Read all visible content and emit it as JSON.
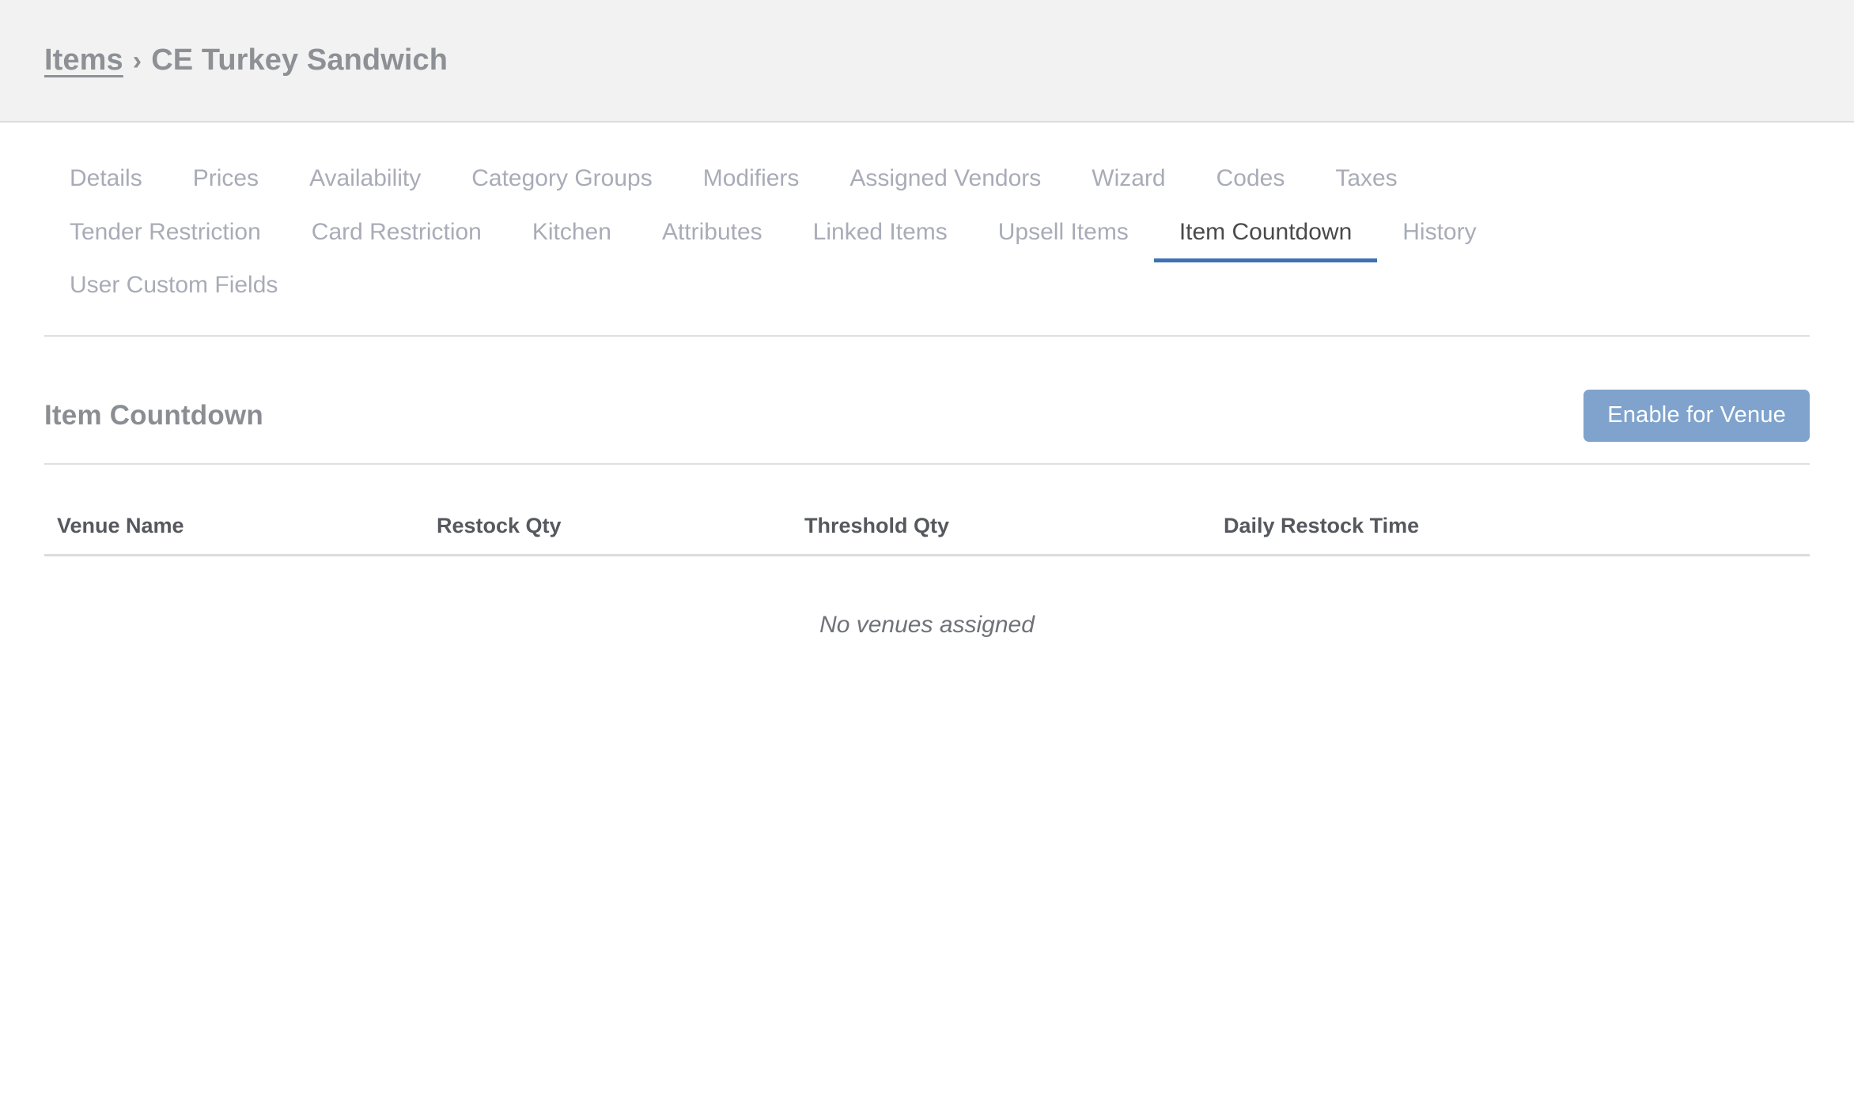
{
  "header": {
    "breadcrumb": {
      "root_label": "Items",
      "separator": "›",
      "current_label": "CE Turkey Sandwich"
    }
  },
  "tabs": {
    "active": "Item Countdown",
    "rows": [
      [
        {
          "label": "Details",
          "active": false
        },
        {
          "label": "Prices",
          "active": false
        },
        {
          "label": "Availability",
          "active": false
        },
        {
          "label": "Category Groups",
          "active": false
        },
        {
          "label": "Modifiers",
          "active": false
        },
        {
          "label": "Assigned Vendors",
          "active": false
        },
        {
          "label": "Wizard",
          "active": false
        },
        {
          "label": "Codes",
          "active": false
        },
        {
          "label": "Taxes",
          "active": false
        }
      ],
      [
        {
          "label": "Tender Restriction",
          "active": false
        },
        {
          "label": "Card Restriction",
          "active": false
        },
        {
          "label": "Kitchen",
          "active": false
        },
        {
          "label": "Attributes",
          "active": false
        },
        {
          "label": "Linked Items",
          "active": false
        },
        {
          "label": "Upsell Items",
          "active": false
        },
        {
          "label": "Item Countdown",
          "active": true
        },
        {
          "label": "History",
          "active": false
        }
      ],
      [
        {
          "label": "User Custom Fields",
          "active": false
        }
      ]
    ]
  },
  "section": {
    "title": "Item Countdown",
    "enable_button_label": "Enable for Venue"
  },
  "table": {
    "columns": [
      {
        "label": "Venue Name"
      },
      {
        "label": "Restock Qty"
      },
      {
        "label": "Threshold Qty"
      },
      {
        "label": "Daily Restock Time"
      }
    ],
    "rows": [],
    "empty_message": "No venues assigned"
  },
  "colors": {
    "header_bg": "#f2f2f2",
    "accent_blue": "#3d72b4",
    "button_blue": "#7fa3cd",
    "tab_inactive": "#a9acb7",
    "tab_active": "#4a4a4a",
    "heading_gray": "#8a8d92",
    "divider": "#dfdfdf"
  }
}
